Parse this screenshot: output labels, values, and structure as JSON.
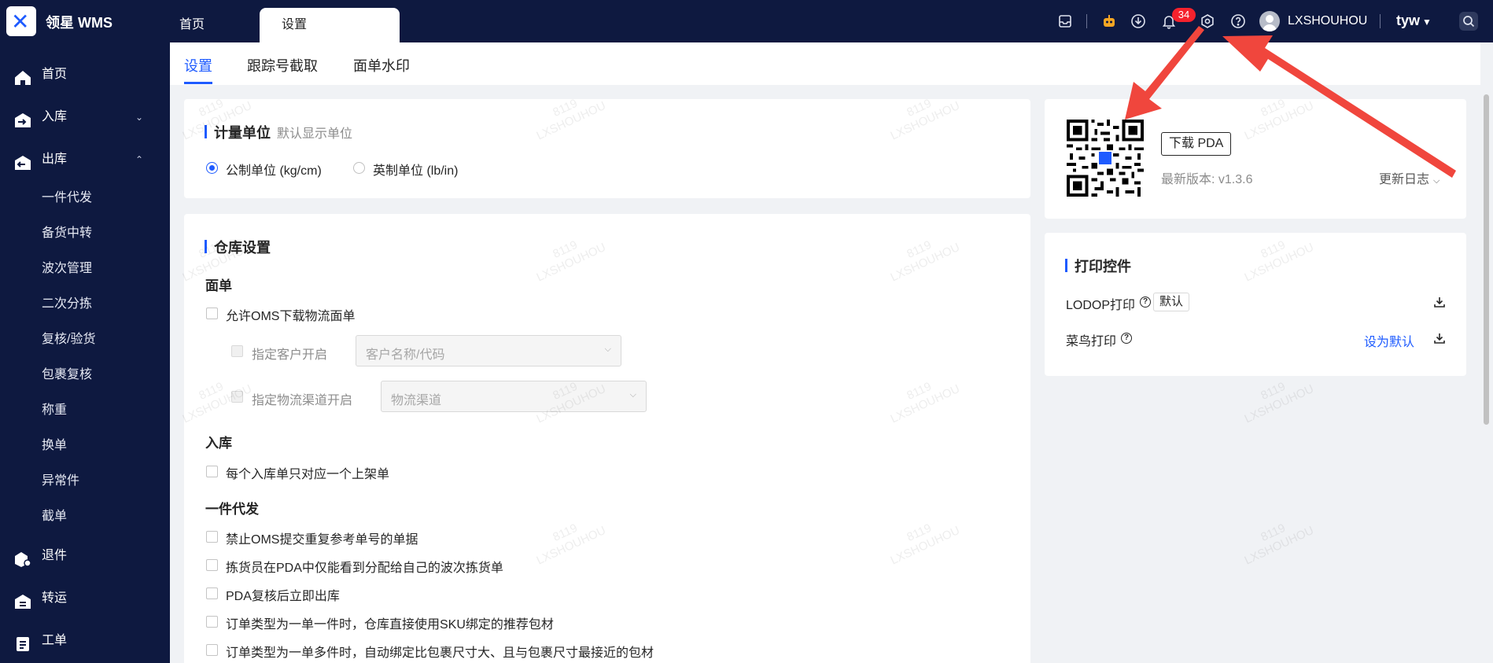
{
  "app": {
    "brand": "领星 WMS",
    "tabs": [
      {
        "label": "首页"
      },
      {
        "label": "设置"
      }
    ],
    "notification_count": "34",
    "username": "LXSHOUHOU",
    "tenant": "tyw"
  },
  "icons": {
    "header": [
      "inbox-icon",
      "robot-icon",
      "download-circle-icon",
      "bell-icon",
      "settings-icon",
      "help-icon",
      "search-icon"
    ],
    "accent_color": "#1e5bff",
    "arrow_color": "#f0463d",
    "bot_color": "#f5a623"
  },
  "sidebar": {
    "items": [
      {
        "label": "首页",
        "icon": "home-icon"
      },
      {
        "label": "入库",
        "icon": "inbound-icon",
        "chevron": "⌄"
      },
      {
        "label": "出库",
        "icon": "outbound-icon",
        "chevron": "⌃"
      },
      {
        "label": "退件",
        "icon": "return-icon"
      },
      {
        "label": "转运",
        "icon": "transfer-icon"
      },
      {
        "label": "工单",
        "icon": "work-order-icon"
      }
    ],
    "outbound_children": [
      "一件代发",
      "备货中转",
      "波次管理",
      "二次分拣",
      "复核/验货",
      "包裹复核",
      "称重",
      "换单",
      "异常件",
      "截单"
    ]
  },
  "subnav": {
    "tabs": [
      "设置",
      "跟踪号截取",
      "面单水印"
    ],
    "active": 0
  },
  "unit_card": {
    "title": "计量单位",
    "hint": "默认显示单位",
    "options": [
      {
        "label": "公制单位 (kg/cm)",
        "selected": true
      },
      {
        "label": "英制单位 (lb/in)",
        "selected": false
      }
    ]
  },
  "warehouse_card": {
    "title": "仓库设置",
    "groups": {
      "label": "面单",
      "allow_oms": "允许OMS下载物流面单",
      "customer_open": "指定客户开启",
      "customer_placeholder": "客户名称/代码",
      "channel_open": "指定物流渠道开启",
      "channel_placeholder": "物流渠道"
    },
    "inbound": {
      "label": "入库",
      "opt": "每个入库单只对应一个上架单"
    },
    "dropship": {
      "label": "一件代发",
      "opts": [
        "禁止OMS提交重复参考单号的单据",
        "拣货员在PDA中仅能看到分配给自己的波次拣货单",
        "PDA复核后立即出库",
        "订单类型为一单一件时，仓库直接使用SKU绑定的推荐包材",
        "订单类型为一单多件时，自动绑定比包裹尺寸大、且与包裹尺寸最接近的包材"
      ]
    }
  },
  "pda_card": {
    "download_label": "下载 PDA",
    "version": "最新版本: v1.3.6",
    "changelog": "更新日志"
  },
  "print_card": {
    "title": "打印控件",
    "lodop": "LODOP打印",
    "default_tag": "默认",
    "cainiao": "菜鸟打印",
    "set_default": "设为默认"
  },
  "watermark": {
    "line1": "8119",
    "line2": "LXSHOUHOU"
  }
}
